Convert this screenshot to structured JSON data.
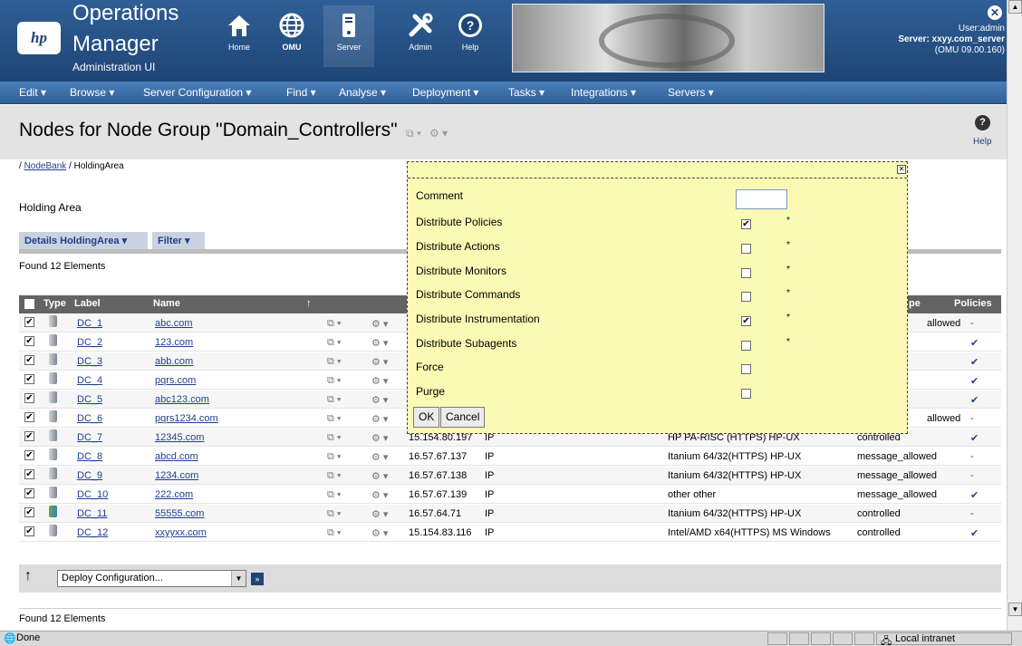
{
  "header": {
    "logo": "hp",
    "product_line1": "Operations",
    "product_line2": "Manager",
    "product_sub": "Administration UI",
    "nav": [
      {
        "label": "Home",
        "icon": "home-icon"
      },
      {
        "label": "OMU",
        "icon": "globe-icon"
      },
      {
        "label": "Server",
        "icon": "server-icon"
      },
      {
        "label": "Admin",
        "icon": "tools-icon"
      },
      {
        "label": "Help",
        "icon": "help-icon"
      }
    ],
    "user": "User:admin",
    "server": "Server: xxyy.com_server",
    "version": "(OMU 09.00.160)"
  },
  "menu": [
    "Edit",
    "Browse",
    "Server Configuration",
    "Find",
    "Analyse",
    "Deployment",
    "Tasks",
    "Integrations",
    "Servers"
  ],
  "page": {
    "title": "Nodes for Node Group \"Domain_Controllers\"",
    "help_label": "Help",
    "breadcrumb_sep": "/",
    "breadcrumb_link": "NodeBank",
    "breadcrumb_current": "HoldingArea",
    "holding_area": "Holding Area",
    "tab_details": "Details HoldingArea",
    "tab_filter": "Filter",
    "found": "Found 12 Elements"
  },
  "table": {
    "headers": {
      "type": "Type",
      "label": "Label",
      "name": "Name",
      "type2": "pe",
      "policies": "Policies"
    },
    "rows": [
      {
        "label": "DC_1",
        "name": "abc.com",
        "ip": "",
        "ip_type": "",
        "os": "",
        "mode": "allowed",
        "policies": "-"
      },
      {
        "label": "DC_2",
        "name": "123.com",
        "ip": "",
        "ip_type": "",
        "os": "",
        "mode": "",
        "policies": "✔"
      },
      {
        "label": "DC_3",
        "name": "abb.com",
        "ip": "",
        "ip_type": "",
        "os": "",
        "mode": "",
        "policies": "✔"
      },
      {
        "label": "DC_4",
        "name": "pqrs.com",
        "ip": "",
        "ip_type": "",
        "os": "",
        "mode": "",
        "policies": "✔"
      },
      {
        "label": "DC_5",
        "name": "abc123.com",
        "ip": "",
        "ip_type": "",
        "os": "",
        "mode": "",
        "policies": "✔"
      },
      {
        "label": "DC_6",
        "name": "pqrs1234.com",
        "ip": "",
        "ip_type": "",
        "os": "",
        "mode": "allowed",
        "policies": "-"
      },
      {
        "label": "DC_7",
        "name": "12345.com",
        "ip": "15.154.80.197",
        "ip_type": "IP",
        "os": "HP PA-RISC (HTTPS) HP-UX",
        "mode": "controlled",
        "policies": "✔"
      },
      {
        "label": "DC_8",
        "name": "abcd.com",
        "ip": "16.57.67.137",
        "ip_type": "IP",
        "os": "Itanium 64/32(HTTPS) HP-UX",
        "mode": "message_allowed",
        "policies": "-"
      },
      {
        "label": "DC_9",
        "name": "1234.com",
        "ip": "16.57.67.138",
        "ip_type": "IP",
        "os": "Itanium 64/32(HTTPS) HP-UX",
        "mode": "message_allowed",
        "policies": "-"
      },
      {
        "label": "DC_10",
        "name": "222.com",
        "ip": "16.57.67.139",
        "ip_type": "IP",
        "os": "other other",
        "mode": "message_allowed",
        "policies": "✔"
      },
      {
        "label": "DC_11",
        "name": "55555.com",
        "ip": "16.57.64.71",
        "ip_type": "IP",
        "os": "Itanium 64/32(HTTPS) HP-UX",
        "mode": "controlled",
        "policies": "-"
      },
      {
        "label": "DC_12",
        "name": "xxyyxx.com",
        "ip": "15.154.83.116",
        "ip_type": "IP",
        "os": "Intel/AMD x64(HTTPS) MS Windows",
        "mode": "controlled",
        "policies": "✔"
      }
    ]
  },
  "action_bar": {
    "select_value": "Deploy Configuration..."
  },
  "dialog": {
    "comment_label": "Comment",
    "comment_value": "",
    "options": [
      {
        "label": "Distribute Policies",
        "checked": true,
        "star": "*"
      },
      {
        "label": "Distribute Actions",
        "checked": false,
        "star": "*"
      },
      {
        "label": "Distribute Monitors",
        "checked": false,
        "star": "*"
      },
      {
        "label": "Distribute Commands",
        "checked": false,
        "star": "*"
      },
      {
        "label": "Distribute Instrumentation",
        "checked": true,
        "star": "*"
      },
      {
        "label": "Distribute Subagents",
        "checked": false,
        "star": "*"
      },
      {
        "label": "Force",
        "checked": false,
        "star": ""
      },
      {
        "label": "Purge",
        "checked": false,
        "star": ""
      }
    ],
    "ok": "OK",
    "cancel": "Cancel"
  },
  "status": {
    "left": "Done",
    "zone": "Local intranet"
  },
  "colors": {
    "header": "#1e4576",
    "dialog_bg": "#fafab4",
    "table_header": "#636363"
  }
}
